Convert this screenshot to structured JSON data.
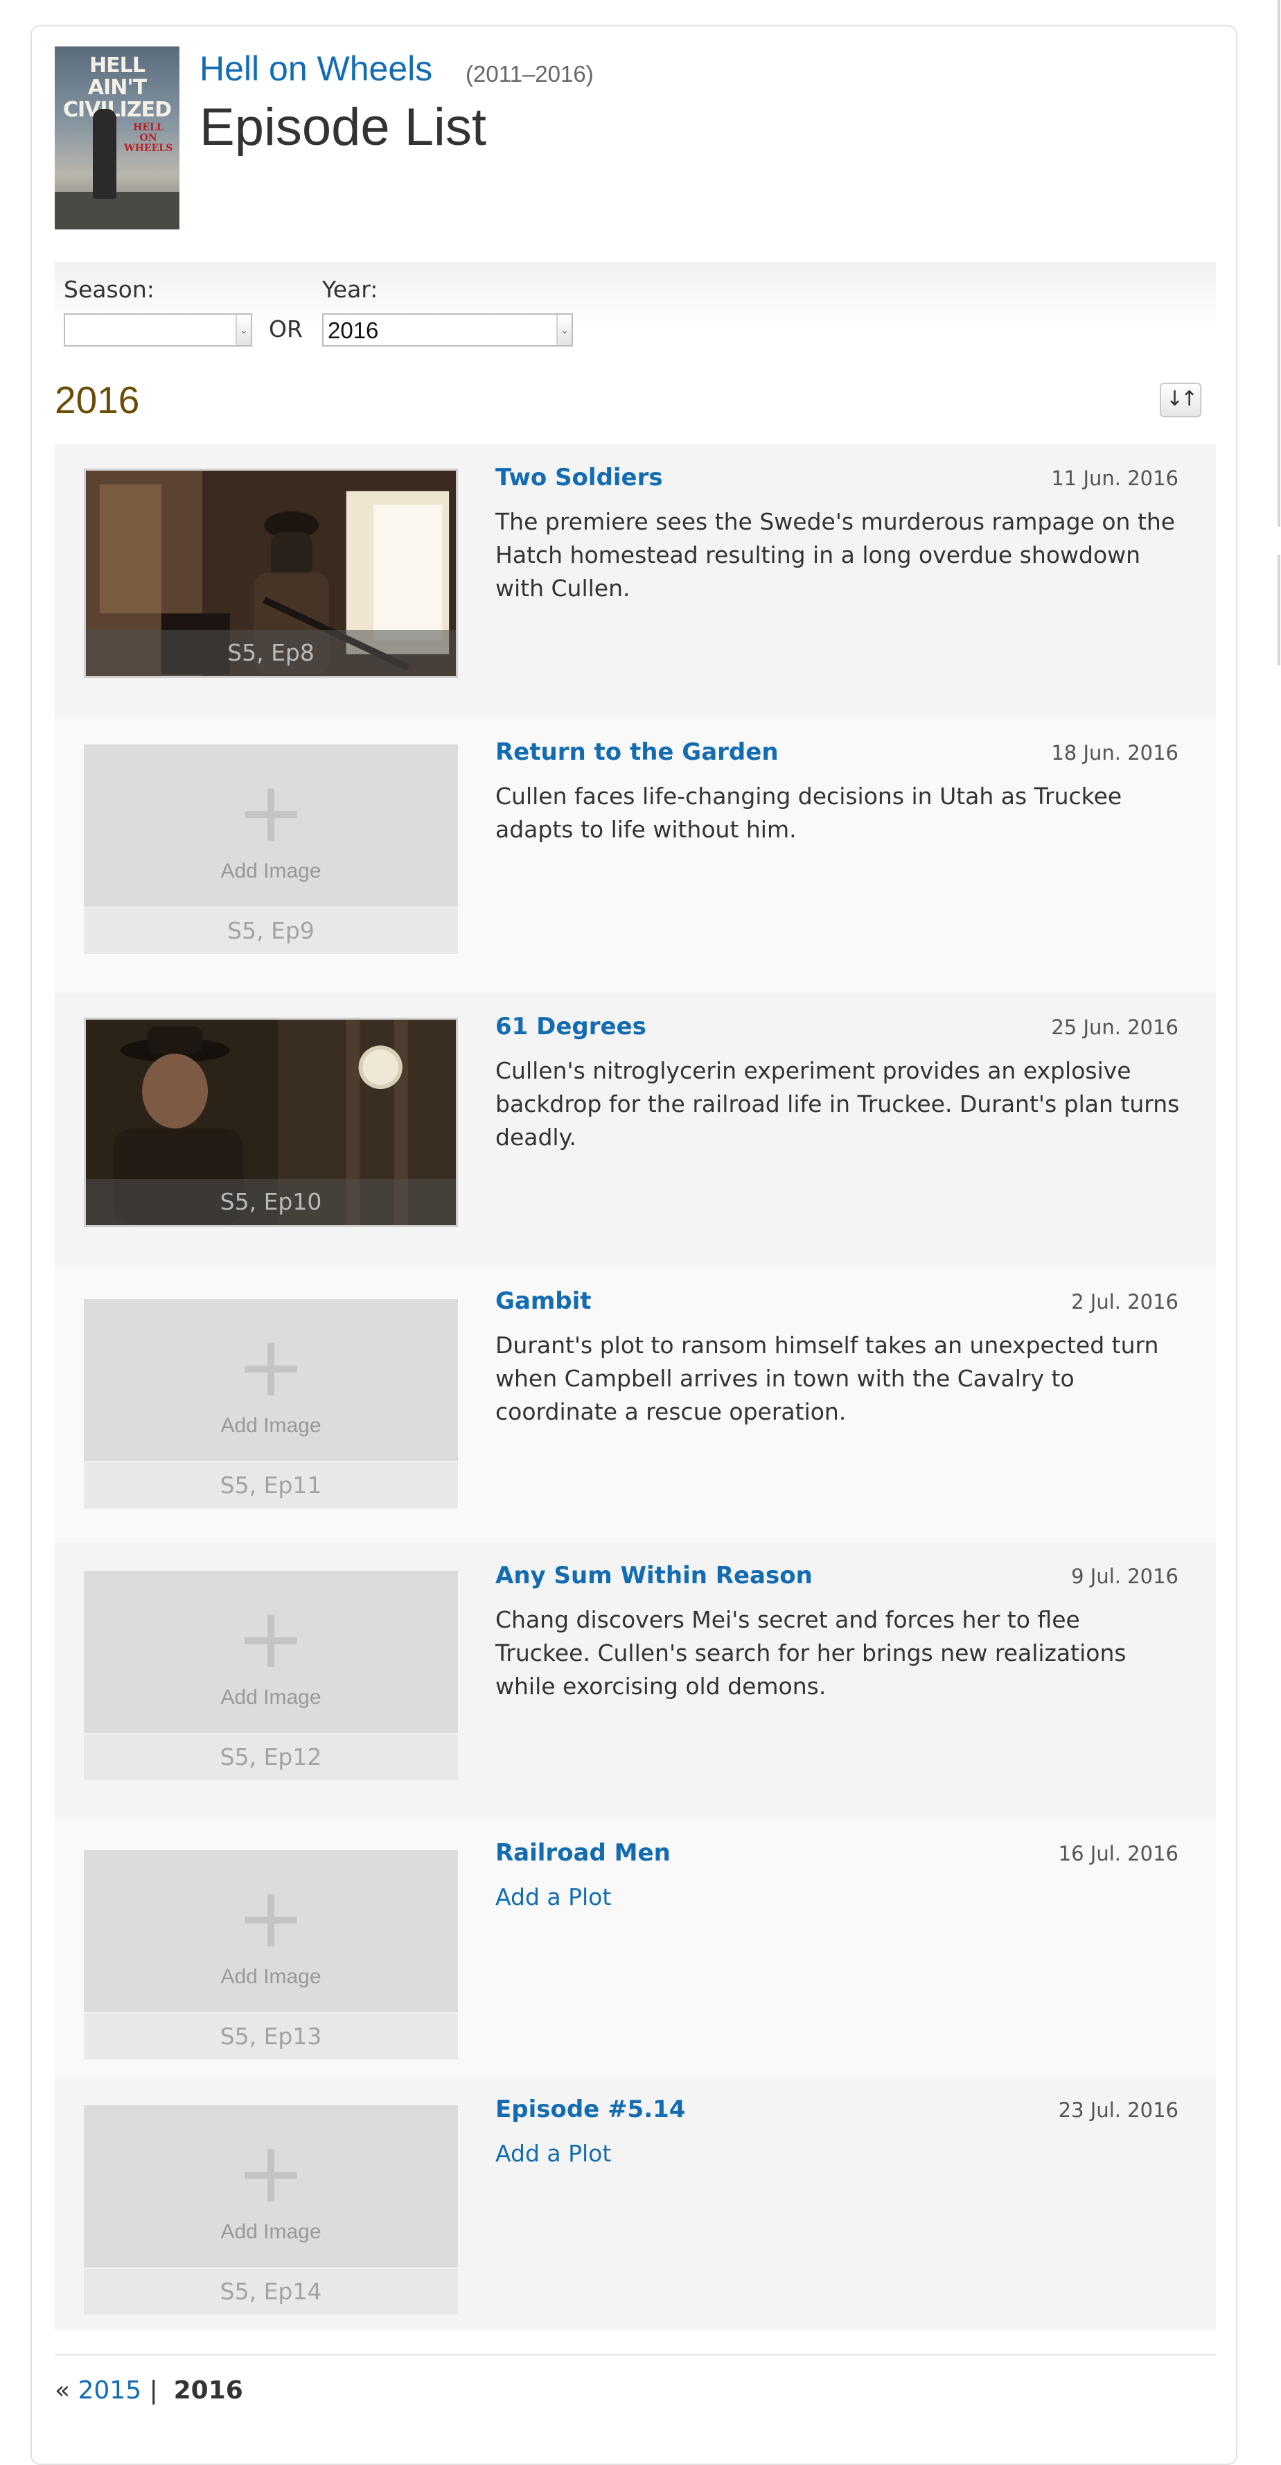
{
  "show": {
    "title": "Hell on Wheels",
    "years": "(2011–2016)",
    "poster": {
      "tagline": "HELL AIN'T CIVILIZED",
      "title": "HELL ON WHEELS"
    }
  },
  "page": {
    "title": "Episode List"
  },
  "filters": {
    "season_label": "Season:",
    "season_value": "",
    "or_label": "OR",
    "year_label": "Year:",
    "year_value": "2016"
  },
  "section": {
    "year_heading": "2016",
    "sort_icon": "sort-toggle-icon"
  },
  "episodes": [
    {
      "title": "Two Soldiers",
      "date": "11 Jun. 2016",
      "plot": "The premiere sees the Swede's murderous rampage on the Hatch homestead resulting in a long overdue showdown with Cullen.",
      "label": "S5, Ep8",
      "has_image": true
    },
    {
      "title": "Return to the Garden",
      "date": "18 Jun. 2016",
      "plot": "Cullen faces life-changing decisions in Utah as Truckee adapts to life without him.",
      "label": "S5, Ep9",
      "has_image": false,
      "add_image": "Add Image"
    },
    {
      "title": "61 Degrees",
      "date": "25 Jun. 2016",
      "plot": "Cullen's nitroglycerin experiment provides an explosive backdrop for the railroad life in Truckee. Durant's plan turns deadly.",
      "label": "S5, Ep10",
      "has_image": true
    },
    {
      "title": "Gambit",
      "date": "2 Jul. 2016",
      "plot": "Durant's plot to ransom himself takes an unexpected turn when Campbell arrives in town with the Cavalry to coordinate a rescue operation.",
      "label": "S5, Ep11",
      "has_image": false,
      "add_image": "Add Image"
    },
    {
      "title": "Any Sum Within Reason",
      "date": "9 Jul. 2016",
      "plot": "Chang discovers Mei's secret and forces her to flee Truckee. Cullen's search for her brings new realizations while exorcising old demons.",
      "label": "S5, Ep12",
      "has_image": false,
      "add_image": "Add Image"
    },
    {
      "title": "Railroad Men",
      "date": "16 Jul. 2016",
      "plot": "Add a Plot",
      "label": "S5, Ep13",
      "has_image": false,
      "add_image": "Add Image"
    },
    {
      "title": "Episode #5.14",
      "date": "23 Jul. 2016",
      "plot": "Add a Plot",
      "label": "S5, Ep14",
      "has_image": false,
      "add_image": "Add Image"
    }
  ],
  "pager": {
    "prefix": "«",
    "prev_year": "2015",
    "separator": "|",
    "current_year": "2016"
  }
}
